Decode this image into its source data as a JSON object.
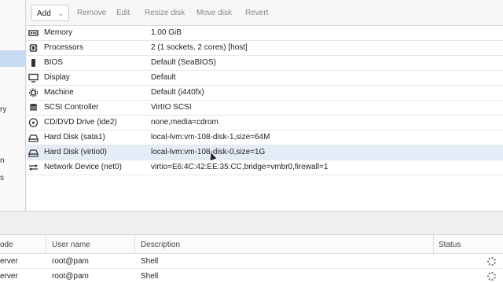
{
  "left_nav": {
    "fragments": [
      "ry",
      "n",
      "s"
    ]
  },
  "toolbar": {
    "add_label": "Add",
    "add_caret": "⌄",
    "remove_label": "Remove",
    "edit_label": "Edit",
    "resize_label": "Resize disk",
    "move_label": "Move disk",
    "revert_label": "Revert"
  },
  "hardware": [
    {
      "icon": "memory-icon",
      "name": "Memory",
      "value": "1.00 GiB"
    },
    {
      "icon": "cpu-icon",
      "name": "Processors",
      "value": "2 (1 sockets, 2 cores) [host]"
    },
    {
      "icon": "bios-icon",
      "name": "BIOS",
      "value": "Default (SeaBIOS)"
    },
    {
      "icon": "display-icon",
      "name": "Display",
      "value": "Default"
    },
    {
      "icon": "machine-icon",
      "name": "Machine",
      "value": "Default (i440fx)"
    },
    {
      "icon": "scsi-icon",
      "name": "SCSI Controller",
      "value": "VirtIO SCSI"
    },
    {
      "icon": "cdrom-icon",
      "name": "CD/DVD Drive (ide2)",
      "value": "none,media=cdrom"
    },
    {
      "icon": "harddisk-icon",
      "name": "Hard Disk (sata1)",
      "value": "local-lvm:vm-108-disk-1,size=64M"
    },
    {
      "icon": "harddisk-icon",
      "name": "Hard Disk (virtio0)",
      "value": "local-lvm:vm-108-disk-0,size=1G"
    },
    {
      "icon": "network-icon",
      "name": "Network Device (net0)",
      "value": "virtio=E6:4C:42:EE:35:CC,bridge=vmbr0,firewall=1"
    }
  ],
  "tasks": {
    "columns": [
      "ode",
      "User name",
      "Description",
      "Status"
    ],
    "rows": [
      {
        "node": "erver",
        "user": "root@pam",
        "description": "Shell"
      },
      {
        "node": "erver",
        "user": "root@pam",
        "description": "Shell"
      }
    ]
  }
}
